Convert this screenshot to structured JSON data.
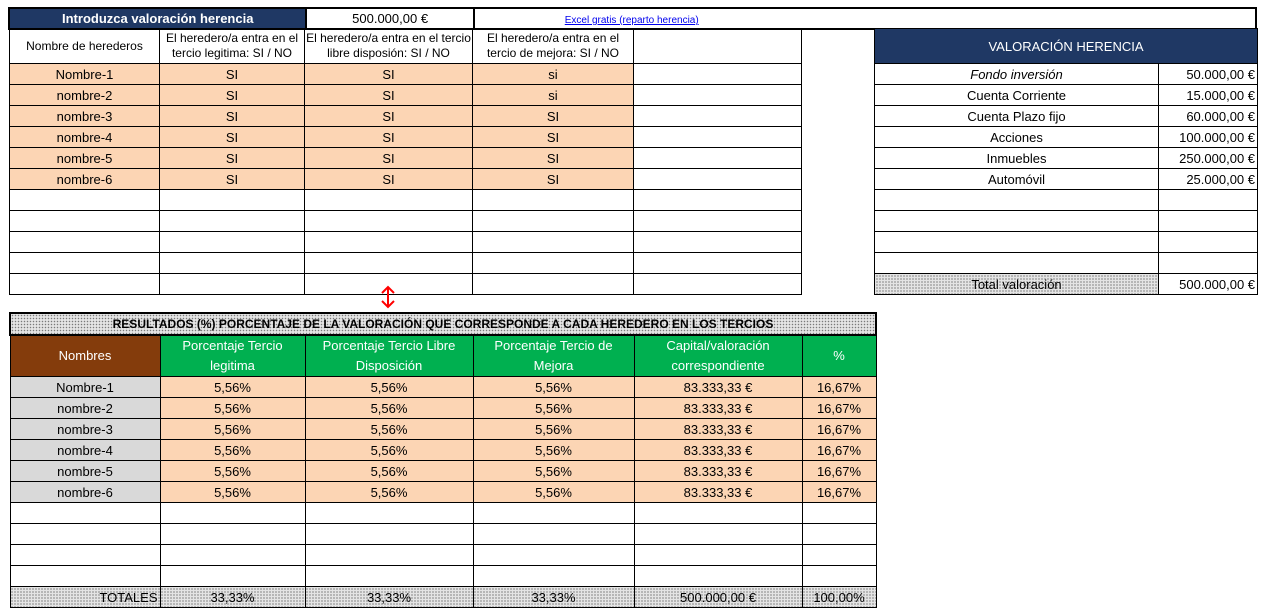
{
  "input": {
    "label": "Introduzca valoración herencia",
    "value": "500.000,00 €",
    "link": "Excel gratis (reparto herencia)"
  },
  "heirs_table": {
    "headers": [
      "Nombre de herederos",
      "El heredero/a entra en el tercio legitima: SI / NO",
      "El heredero/a entra en el tercio libre disposión: SI / NO",
      "El heredero/a entra en el tercio de mejora:  SI / NO",
      ""
    ],
    "rows": [
      [
        "Nombre-1",
        "SI",
        "SI",
        "si",
        ""
      ],
      [
        "nombre-2",
        "SI",
        "SI",
        "si",
        ""
      ],
      [
        "nombre-3",
        "SI",
        "SI",
        "SI",
        ""
      ],
      [
        "nombre-4",
        "SI",
        "SI",
        "SI",
        ""
      ],
      [
        "nombre-5",
        "SI",
        "SI",
        "SI",
        ""
      ],
      [
        "nombre-6",
        "SI",
        "SI",
        "SI",
        ""
      ]
    ]
  },
  "valuation": {
    "title": "VALORACIÓN HERENCIA",
    "items": [
      {
        "label": "Fondo inversión",
        "value": "50.000,00 €",
        "italic": true
      },
      {
        "label": "Cuenta Corriente",
        "value": "15.000,00 €"
      },
      {
        "label": "Cuenta Plazo fijo",
        "value": "60.000,00 €"
      },
      {
        "label": "Acciones",
        "value": "100.000,00 €"
      },
      {
        "label": "Inmuebles",
        "value": "250.000,00 €"
      },
      {
        "label": "Automóvil",
        "value": "25.000,00 €"
      }
    ],
    "total_label": "Total valoración",
    "total_value": "500.000,00 €"
  },
  "results": {
    "title": "RESULTADOS (%) PORCENTAJE DE LA VALORACIÓN QUE CORRESPONDE A CADA HEREDERO EN LOS TERCIOS",
    "headers": [
      "Nombres",
      "Porcentaje Tercio legitima",
      "Porcentaje Tercio  Libre Disposición",
      "Porcentaje  Tercio de Mejora",
      "Capital/valoración correspondiente",
      "%"
    ],
    "rows": [
      [
        "Nombre-1",
        "5,56%",
        "5,56%",
        "5,56%",
        "83.333,33 €",
        "16,67%"
      ],
      [
        "nombre-2",
        "5,56%",
        "5,56%",
        "5,56%",
        "83.333,33 €",
        "16,67%"
      ],
      [
        "nombre-3",
        "5,56%",
        "5,56%",
        "5,56%",
        "83.333,33 €",
        "16,67%"
      ],
      [
        "nombre-4",
        "5,56%",
        "5,56%",
        "5,56%",
        "83.333,33 €",
        "16,67%"
      ],
      [
        "nombre-5",
        "5,56%",
        "5,56%",
        "5,56%",
        "83.333,33 €",
        "16,67%"
      ],
      [
        "nombre-6",
        "5,56%",
        "5,56%",
        "5,56%",
        "83.333,33 €",
        "16,67%"
      ]
    ],
    "totals": [
      "TOTALES",
      "33,33%",
      "33,33%",
      "33,33%",
      "500.000,00 €",
      "100,00%"
    ]
  },
  "colors": {
    "navy": "#1f3864",
    "green": "#00b050",
    "brown": "#843c0c",
    "peach": "#fcd5b4",
    "grey": "#d9d9d9",
    "arrow": "#ff0000"
  },
  "icons": {
    "arrow": "up-down-arrow-icon"
  }
}
